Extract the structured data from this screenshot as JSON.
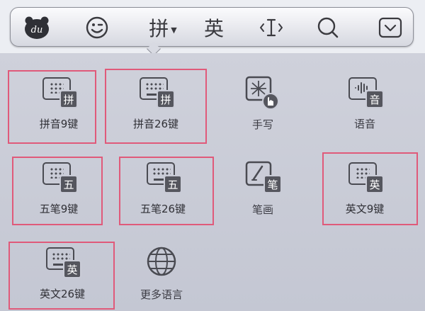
{
  "toolbar": {
    "logo_text": "du",
    "pinyin_label": "拼",
    "english_label": "英"
  },
  "modes": [
    {
      "label": "拼音9键",
      "badge": "拼",
      "icon": "keypad-9-icon",
      "selected": true
    },
    {
      "label": "拼音26键",
      "badge": "拼",
      "icon": "keyboard-26-icon",
      "selected": true
    },
    {
      "label": "手写",
      "badge": "",
      "icon": "handwriting-icon",
      "selected": false
    },
    {
      "label": "语音",
      "badge": "音",
      "icon": "voice-icon",
      "selected": false
    },
    {
      "label": "五笔9键",
      "badge": "五",
      "icon": "keypad-9-icon",
      "selected": true
    },
    {
      "label": "五笔26键",
      "badge": "五",
      "icon": "keyboard-26-icon",
      "selected": true
    },
    {
      "label": "笔画",
      "badge": "笔",
      "icon": "stroke-icon",
      "selected": false
    },
    {
      "label": "英文9键",
      "badge": "英",
      "icon": "keypad-9-icon",
      "selected": true
    },
    {
      "label": "英文26键",
      "badge": "英",
      "icon": "keyboard-26-icon",
      "selected": true
    },
    {
      "label": "更多语言",
      "badge": "",
      "icon": "globe-icon",
      "selected": false
    }
  ],
  "colors": {
    "highlight": "#e05a7a",
    "icon": "#4a4b52",
    "background": "#c9cbd6"
  }
}
